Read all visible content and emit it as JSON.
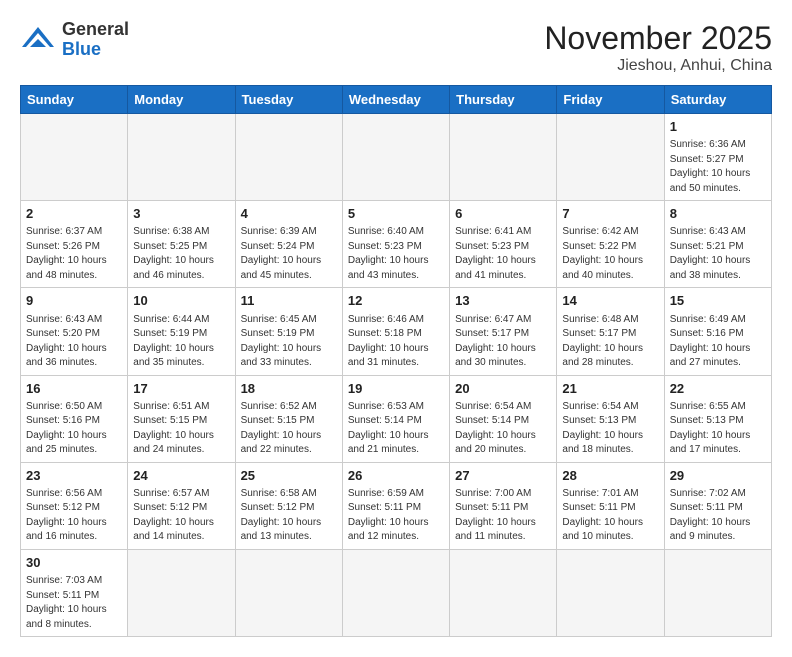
{
  "logo": {
    "general": "General",
    "blue": "Blue"
  },
  "header": {
    "month": "November 2025",
    "location": "Jieshou, Anhui, China"
  },
  "days_of_week": [
    "Sunday",
    "Monday",
    "Tuesday",
    "Wednesday",
    "Thursday",
    "Friday",
    "Saturday"
  ],
  "weeks": [
    [
      {
        "day": "",
        "info": ""
      },
      {
        "day": "",
        "info": ""
      },
      {
        "day": "",
        "info": ""
      },
      {
        "day": "",
        "info": ""
      },
      {
        "day": "",
        "info": ""
      },
      {
        "day": "",
        "info": ""
      },
      {
        "day": "1",
        "info": "Sunrise: 6:36 AM\nSunset: 5:27 PM\nDaylight: 10 hours\nand 50 minutes."
      }
    ],
    [
      {
        "day": "2",
        "info": "Sunrise: 6:37 AM\nSunset: 5:26 PM\nDaylight: 10 hours\nand 48 minutes."
      },
      {
        "day": "3",
        "info": "Sunrise: 6:38 AM\nSunset: 5:25 PM\nDaylight: 10 hours\nand 46 minutes."
      },
      {
        "day": "4",
        "info": "Sunrise: 6:39 AM\nSunset: 5:24 PM\nDaylight: 10 hours\nand 45 minutes."
      },
      {
        "day": "5",
        "info": "Sunrise: 6:40 AM\nSunset: 5:23 PM\nDaylight: 10 hours\nand 43 minutes."
      },
      {
        "day": "6",
        "info": "Sunrise: 6:41 AM\nSunset: 5:23 PM\nDaylight: 10 hours\nand 41 minutes."
      },
      {
        "day": "7",
        "info": "Sunrise: 6:42 AM\nSunset: 5:22 PM\nDaylight: 10 hours\nand 40 minutes."
      },
      {
        "day": "8",
        "info": "Sunrise: 6:43 AM\nSunset: 5:21 PM\nDaylight: 10 hours\nand 38 minutes."
      }
    ],
    [
      {
        "day": "9",
        "info": "Sunrise: 6:43 AM\nSunset: 5:20 PM\nDaylight: 10 hours\nand 36 minutes."
      },
      {
        "day": "10",
        "info": "Sunrise: 6:44 AM\nSunset: 5:19 PM\nDaylight: 10 hours\nand 35 minutes."
      },
      {
        "day": "11",
        "info": "Sunrise: 6:45 AM\nSunset: 5:19 PM\nDaylight: 10 hours\nand 33 minutes."
      },
      {
        "day": "12",
        "info": "Sunrise: 6:46 AM\nSunset: 5:18 PM\nDaylight: 10 hours\nand 31 minutes."
      },
      {
        "day": "13",
        "info": "Sunrise: 6:47 AM\nSunset: 5:17 PM\nDaylight: 10 hours\nand 30 minutes."
      },
      {
        "day": "14",
        "info": "Sunrise: 6:48 AM\nSunset: 5:17 PM\nDaylight: 10 hours\nand 28 minutes."
      },
      {
        "day": "15",
        "info": "Sunrise: 6:49 AM\nSunset: 5:16 PM\nDaylight: 10 hours\nand 27 minutes."
      }
    ],
    [
      {
        "day": "16",
        "info": "Sunrise: 6:50 AM\nSunset: 5:16 PM\nDaylight: 10 hours\nand 25 minutes."
      },
      {
        "day": "17",
        "info": "Sunrise: 6:51 AM\nSunset: 5:15 PM\nDaylight: 10 hours\nand 24 minutes."
      },
      {
        "day": "18",
        "info": "Sunrise: 6:52 AM\nSunset: 5:15 PM\nDaylight: 10 hours\nand 22 minutes."
      },
      {
        "day": "19",
        "info": "Sunrise: 6:53 AM\nSunset: 5:14 PM\nDaylight: 10 hours\nand 21 minutes."
      },
      {
        "day": "20",
        "info": "Sunrise: 6:54 AM\nSunset: 5:14 PM\nDaylight: 10 hours\nand 20 minutes."
      },
      {
        "day": "21",
        "info": "Sunrise: 6:54 AM\nSunset: 5:13 PM\nDaylight: 10 hours\nand 18 minutes."
      },
      {
        "day": "22",
        "info": "Sunrise: 6:55 AM\nSunset: 5:13 PM\nDaylight: 10 hours\nand 17 minutes."
      }
    ],
    [
      {
        "day": "23",
        "info": "Sunrise: 6:56 AM\nSunset: 5:12 PM\nDaylight: 10 hours\nand 16 minutes."
      },
      {
        "day": "24",
        "info": "Sunrise: 6:57 AM\nSunset: 5:12 PM\nDaylight: 10 hours\nand 14 minutes."
      },
      {
        "day": "25",
        "info": "Sunrise: 6:58 AM\nSunset: 5:12 PM\nDaylight: 10 hours\nand 13 minutes."
      },
      {
        "day": "26",
        "info": "Sunrise: 6:59 AM\nSunset: 5:11 PM\nDaylight: 10 hours\nand 12 minutes."
      },
      {
        "day": "27",
        "info": "Sunrise: 7:00 AM\nSunset: 5:11 PM\nDaylight: 10 hours\nand 11 minutes."
      },
      {
        "day": "28",
        "info": "Sunrise: 7:01 AM\nSunset: 5:11 PM\nDaylight: 10 hours\nand 10 minutes."
      },
      {
        "day": "29",
        "info": "Sunrise: 7:02 AM\nSunset: 5:11 PM\nDaylight: 10 hours\nand 9 minutes."
      }
    ],
    [
      {
        "day": "30",
        "info": "Sunrise: 7:03 AM\nSunset: 5:11 PM\nDaylight: 10 hours\nand 8 minutes."
      },
      {
        "day": "",
        "info": ""
      },
      {
        "day": "",
        "info": ""
      },
      {
        "day": "",
        "info": ""
      },
      {
        "day": "",
        "info": ""
      },
      {
        "day": "",
        "info": ""
      },
      {
        "day": "",
        "info": ""
      }
    ]
  ]
}
